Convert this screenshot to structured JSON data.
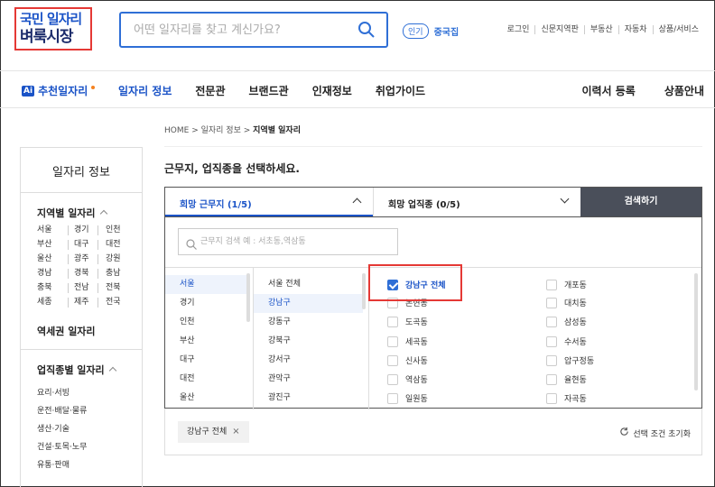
{
  "logo": {
    "line1": "국민 일자리",
    "line2": "벼룩시장"
  },
  "search": {
    "placeholder": "어떤 일자리를 찾고 계신가요?"
  },
  "popular": {
    "badge": "인기",
    "keyword": "중국집"
  },
  "util_links": [
    "로그인",
    "신문지역판",
    "부동산",
    "자동차",
    "상품/서비스"
  ],
  "nav": {
    "ai_box": "Ai",
    "ai_label": "추천일자리",
    "items": [
      "일자리 정보",
      "전문관",
      "브랜드관",
      "인재정보",
      "취업가이드"
    ],
    "right": [
      "이력서 등록",
      "상품안내"
    ]
  },
  "breadcrumb": {
    "home": "HOME",
    "sep": ">",
    "mid": "일자리 정보",
    "current": "지역별 일자리"
  },
  "sidebar": {
    "title": "일자리 정보",
    "region_title": "지역별 일자리",
    "regions": [
      "서울",
      "경기",
      "인천",
      "부산",
      "대구",
      "대전",
      "울산",
      "광주",
      "강원",
      "경남",
      "경북",
      "충남",
      "충북",
      "전남",
      "전북",
      "세종",
      "제주",
      "전국"
    ],
    "station_title": "역세권 일자리",
    "job_title": "업직종별 일자리",
    "jobs": [
      "요리·서빙",
      "운전·배달·물류",
      "생산·기술",
      "건설·토목·노무",
      "유통·판매"
    ]
  },
  "main": {
    "question": "근무지, 업직종을 선택하세요.",
    "tab_location": "희망 근무지 (1/5)",
    "tab_job": "희망 업직종 (0/5)",
    "search_button": "검색하기",
    "region_search_placeholder": "근무지 검색 예 : 서초동,역삼동",
    "cities": [
      "서울",
      "경기",
      "인천",
      "부산",
      "대구",
      "대전",
      "울산"
    ],
    "districts": [
      "서울 전체",
      "강남구",
      "강동구",
      "강북구",
      "강서구",
      "관악구",
      "광진구"
    ],
    "dongs_left": [
      "강남구 전체",
      "논현동",
      "도곡동",
      "세곡동",
      "신사동",
      "역삼동",
      "일원동"
    ],
    "dongs_right": [
      "개포동",
      "대치동",
      "삼성동",
      "수서동",
      "압구정동",
      "율현동",
      "자곡동"
    ],
    "chip": "강남구 전체",
    "chip_x": "×",
    "reset": "선택 조건 초기화"
  }
}
